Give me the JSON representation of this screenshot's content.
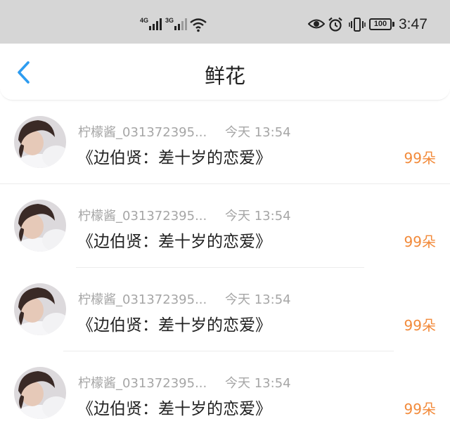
{
  "status_bar": {
    "network_1": "4G",
    "network_2": "3G",
    "battery": "100",
    "time": "3:47"
  },
  "header": {
    "title": "鲜花"
  },
  "items": [
    {
      "username": "柠檬酱_031372395...",
      "timestamp": "今天 13:54",
      "title": "《边伯贤：差十岁的恋爱》",
      "count": "99朵"
    },
    {
      "username": "柠檬酱_031372395...",
      "timestamp": "今天 13:54",
      "title": "《边伯贤：差十岁的恋爱》",
      "count": "99朵"
    },
    {
      "username": "柠檬酱_031372395...",
      "timestamp": "今天 13:54",
      "title": "《边伯贤：差十岁的恋爱》",
      "count": "99朵"
    },
    {
      "username": "柠檬酱_031372395...",
      "timestamp": "今天 13:54",
      "title": "《边伯贤：差十岁的恋爱》",
      "count": "99朵"
    }
  ],
  "colors": {
    "accent": "#2d9cf0",
    "count": "#f28a3a",
    "meta_text": "#a6a6a6",
    "status_bar_bg": "#d6d6d6"
  },
  "icons": {
    "back": "chevron-left-icon",
    "signal": "signal-bars-icon",
    "wifi": "wifi-icon",
    "eye": "eye-icon",
    "alarm": "alarm-clock-icon",
    "vibrate": "vibrate-icon",
    "battery": "battery-icon"
  }
}
